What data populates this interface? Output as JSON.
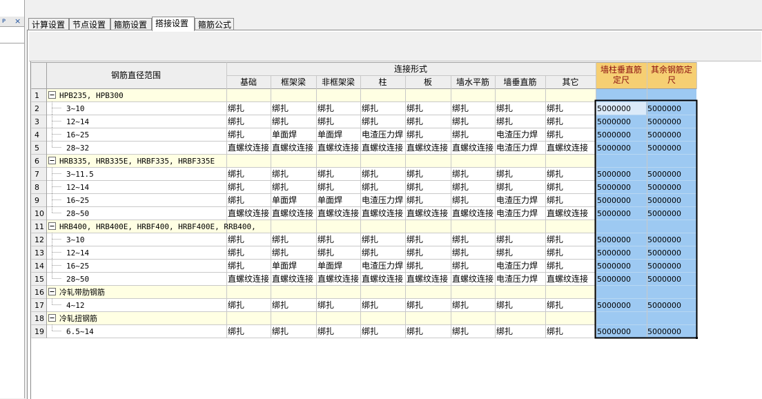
{
  "left_pane": {
    "pin_icon": "pin-icon",
    "close_icon": "close-icon",
    "pin_glyph": "ᴩ",
    "close_glyph": "×"
  },
  "tabs": [
    {
      "label": "计算设置",
      "active": false
    },
    {
      "label": "节点设置",
      "active": false
    },
    {
      "label": "箍筋设置",
      "active": false
    },
    {
      "label": "搭接设置",
      "active": true
    },
    {
      "label": "箍筋公式",
      "active": false
    }
  ],
  "grid": {
    "header": {
      "range_title": "钢筋直径范围",
      "group_title": "连接形式",
      "columns": [
        "基础",
        "框架梁",
        "非框架梁",
        "柱",
        "板",
        "墙水平筋",
        "墙垂直筋",
        "其它"
      ],
      "fixed_length_columns": [
        "墙柱垂直筋定尺",
        "其余钢筋定尺"
      ]
    },
    "rows": [
      {
        "no": "1",
        "type": "group",
        "label": "HPB235, HPB300"
      },
      {
        "no": "2",
        "type": "item",
        "label": "3~10",
        "values": [
          "绑扎",
          "绑扎",
          "绑扎",
          "绑扎",
          "绑扎",
          "绑扎",
          "绑扎",
          "绑扎"
        ],
        "fixed": [
          "5000000",
          "5000000"
        ]
      },
      {
        "no": "3",
        "type": "item",
        "label": "12~14",
        "values": [
          "绑扎",
          "绑扎",
          "绑扎",
          "绑扎",
          "绑扎",
          "绑扎",
          "绑扎",
          "绑扎"
        ],
        "fixed": [
          "5000000",
          "5000000"
        ]
      },
      {
        "no": "4",
        "type": "item",
        "label": "16~25",
        "values": [
          "绑扎",
          "单面焊",
          "单面焊",
          "电渣压力焊",
          "绑扎",
          "绑扎",
          "电渣压力焊",
          "绑扎"
        ],
        "fixed": [
          "5000000",
          "5000000"
        ]
      },
      {
        "no": "5",
        "type": "item",
        "label": "28~32",
        "values": [
          "直螺纹连接",
          "直螺纹连接",
          "直螺纹连接",
          "直螺纹连接",
          "直螺纹连接",
          "直螺纹连接",
          "电渣压力焊",
          "直螺纹连接"
        ],
        "fixed": [
          "5000000",
          "5000000"
        ]
      },
      {
        "no": "6",
        "type": "group",
        "label": "HRB335, HRB335E, HRBF335, HRBF335E"
      },
      {
        "no": "7",
        "type": "item",
        "label": "3~11.5",
        "values": [
          "绑扎",
          "绑扎",
          "绑扎",
          "绑扎",
          "绑扎",
          "绑扎",
          "绑扎",
          "绑扎"
        ],
        "fixed": [
          "5000000",
          "5000000"
        ]
      },
      {
        "no": "8",
        "type": "item",
        "label": "12~14",
        "values": [
          "绑扎",
          "绑扎",
          "绑扎",
          "绑扎",
          "绑扎",
          "绑扎",
          "绑扎",
          "绑扎"
        ],
        "fixed": [
          "5000000",
          "5000000"
        ]
      },
      {
        "no": "9",
        "type": "item",
        "label": "16~25",
        "values": [
          "绑扎",
          "单面焊",
          "单面焊",
          "电渣压力焊",
          "绑扎",
          "绑扎",
          "电渣压力焊",
          "绑扎"
        ],
        "fixed": [
          "5000000",
          "5000000"
        ]
      },
      {
        "no": "10",
        "type": "item",
        "label": "28~50",
        "values": [
          "直螺纹连接",
          "直螺纹连接",
          "直螺纹连接",
          "直螺纹连接",
          "直螺纹连接",
          "直螺纹连接",
          "电渣压力焊",
          "直螺纹连接"
        ],
        "fixed": [
          "5000000",
          "5000000"
        ]
      },
      {
        "no": "11",
        "type": "group",
        "label": "HRB400, HRB400E, HRBF400, HRBF400E, RRB400,"
      },
      {
        "no": "12",
        "type": "item",
        "label": "3~10",
        "values": [
          "绑扎",
          "绑扎",
          "绑扎",
          "绑扎",
          "绑扎",
          "绑扎",
          "绑扎",
          "绑扎"
        ],
        "fixed": [
          "5000000",
          "5000000"
        ]
      },
      {
        "no": "13",
        "type": "item",
        "label": "12~14",
        "values": [
          "绑扎",
          "绑扎",
          "绑扎",
          "绑扎",
          "绑扎",
          "绑扎",
          "绑扎",
          "绑扎"
        ],
        "fixed": [
          "5000000",
          "5000000"
        ]
      },
      {
        "no": "14",
        "type": "item",
        "label": "16~25",
        "values": [
          "绑扎",
          "单面焊",
          "单面焊",
          "电渣压力焊",
          "绑扎",
          "绑扎",
          "电渣压力焊",
          "绑扎"
        ],
        "fixed": [
          "5000000",
          "5000000"
        ]
      },
      {
        "no": "15",
        "type": "item",
        "label": "28~50",
        "values": [
          "直螺纹连接",
          "直螺纹连接",
          "直螺纹连接",
          "直螺纹连接",
          "直螺纹连接",
          "直螺纹连接",
          "电渣压力焊",
          "直螺纹连接"
        ],
        "fixed": [
          "5000000",
          "5000000"
        ]
      },
      {
        "no": "16",
        "type": "group",
        "label": "冷轧带肋钢筋"
      },
      {
        "no": "17",
        "type": "item",
        "label": "4~12",
        "values": [
          "绑扎",
          "绑扎",
          "绑扎",
          "绑扎",
          "绑扎",
          "绑扎",
          "绑扎",
          "绑扎"
        ],
        "fixed": [
          "5000000",
          "5000000"
        ]
      },
      {
        "no": "18",
        "type": "group",
        "label": "冷轧扭钢筋"
      },
      {
        "no": "19",
        "type": "item",
        "label": "6.5~14",
        "values": [
          "绑扎",
          "绑扎",
          "绑扎",
          "绑扎",
          "绑扎",
          "绑扎",
          "绑扎",
          "绑扎"
        ],
        "fixed": [
          "5000000",
          "5000000"
        ]
      }
    ]
  },
  "colors": {
    "header_bg": "#eeeeee",
    "fixed_header_bg": "#f6cf73",
    "fixed_header_text": "#8b1010",
    "group_row_bg": "#ffffe3",
    "selection_bg": "#9dc9f2",
    "active_cell_bg": "#dbeaf9",
    "grid_line": "#c8c8c8"
  }
}
